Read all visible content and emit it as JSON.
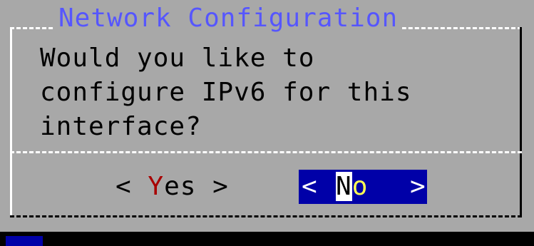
{
  "dialog": {
    "title": "Network Configuration",
    "message_lines": [
      "Would you like to",
      "configure IPv6 for this",
      "interface?"
    ]
  },
  "buttons": {
    "yes": {
      "left_bracket": "<",
      "hotkey": "Y",
      "rest": "es",
      "right_bracket": ">"
    },
    "no": {
      "left_bracket": "<",
      "first": "N",
      "hotkey": "o",
      "right_bracket": ">"
    }
  },
  "colors": {
    "dialog_bg": "#a8a8a8",
    "title": "#5656ff",
    "selected_button_bg": "#0000a8",
    "hotkey_unselected": "#a80000",
    "hotkey_selected": "#ffff54"
  }
}
